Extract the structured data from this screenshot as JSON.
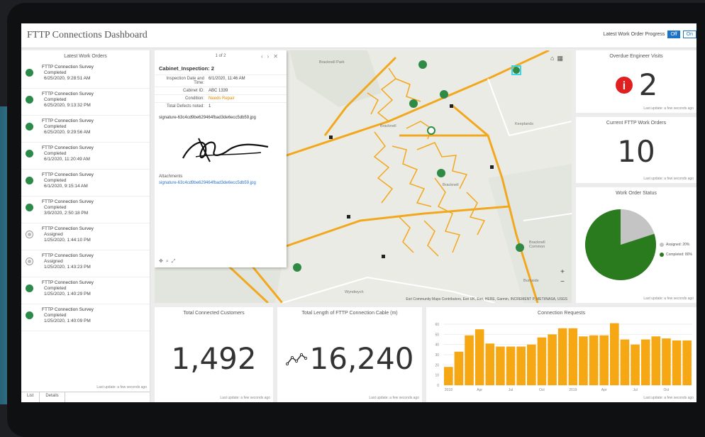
{
  "header": {
    "title": "FTTP Connections Dashboard",
    "selector_label": "Latest Work Order Progress",
    "toggle_off": "Off",
    "toggle_on": "On"
  },
  "work_orders": {
    "title": "Latest Work Orders",
    "items": [
      {
        "title": "FTTP Connection Survey",
        "status": "Completed",
        "date": "6/25/2020, 9:28:51 AM",
        "state": "completed"
      },
      {
        "title": "FTTP Connection Survey",
        "status": "Completed",
        "date": "6/25/2020, 9:13:32 PM",
        "state": "completed"
      },
      {
        "title": "FTTP Connection Survey",
        "status": "Completed",
        "date": "6/25/2020, 9:29:56 AM",
        "state": "completed"
      },
      {
        "title": "FTTP Connection Survey",
        "status": "Completed",
        "date": "6/1/2020, 11:20:49 AM",
        "state": "completed"
      },
      {
        "title": "FTTP Connection Survey",
        "status": "Completed",
        "date": "6/1/2020, 9:15:14 AM",
        "state": "completed"
      },
      {
        "title": "FTTP Connection Survey",
        "status": "Completed",
        "date": "3/9/2020, 2:50:18 PM",
        "state": "completed"
      },
      {
        "title": "FTTP Connection Survey",
        "status": "Assigned",
        "date": "1/25/2020, 1:44:10 PM",
        "state": "assigned"
      },
      {
        "title": "FTTP Connection Survey",
        "status": "Assigned",
        "date": "1/25/2020, 1:43:23 PM",
        "state": "assigned"
      },
      {
        "title": "FTTP Connection Survey",
        "status": "Completed",
        "date": "1/25/2020, 1:40:29 PM",
        "state": "completed"
      },
      {
        "title": "FTTP Connection Survey",
        "status": "Completed",
        "date": "1/25/2020, 1:40:09 PM",
        "state": "completed"
      }
    ],
    "last_update": "Last update: a few seconds ago",
    "tabs": [
      "List",
      "Details"
    ]
  },
  "popup": {
    "counter": "1 of 2",
    "title": "Cabinet_Inspection: 2",
    "fields": [
      {
        "label": "Inspection Date and Time:",
        "value": "6/1/2020, 11:46 AM"
      },
      {
        "label": "Cabinet ID:",
        "value": "ABC 1339"
      },
      {
        "label": "Condition:",
        "value": "Needs Repair"
      },
      {
        "label": "Total Defects noted:",
        "value": "1"
      }
    ],
    "signature_file": "signature-63c4cd9be629464fbad3de6ecc5db59.jpg",
    "attachments_label": "Attachments",
    "attachment_link": "signature-63c4cd9be629464fbad3de6ecc5db59.jpg"
  },
  "map": {
    "attribution": "Esri Community Maps Contributors, Esri UK, Esri, HERE, Garmin, INCREMENT P, METI/NASA, USGS",
    "places": [
      "Bracknell Park",
      "Bracknell",
      "Keeplands",
      "Bracknell",
      "Bracknell Common",
      "Wyndwych",
      "Burnside"
    ]
  },
  "engineer_visits": {
    "title": "Overdue Engineer Visits",
    "value": "2",
    "last_update": "Last update: a few seconds ago"
  },
  "current_orders": {
    "title": "Current FTTP Work Orders",
    "value": "10",
    "last_update": "Last update: a few seconds ago"
  },
  "status_chart": {
    "title": "Work Order Status",
    "last_update": "Last update: a few seconds ago",
    "legend": [
      {
        "label": "Assigned: 20%",
        "color": "#c4c4c4"
      },
      {
        "label": "Completed: 80%",
        "color": "#2a7a1e"
      }
    ]
  },
  "customers": {
    "title": "Total Connected Customers",
    "value": "1,492",
    "last_update": "Last update: a few seconds ago"
  },
  "cable_length": {
    "title": "Total Length of FTTP Connection Cable (m)",
    "value": "16,240",
    "last_update": "Last update: a few seconds ago"
  },
  "requests_chart": {
    "title": "Connection Requests",
    "last_update": "Last update: a few seconds ago"
  },
  "chart_data": [
    {
      "type": "pie",
      "title": "Work Order Status",
      "categories": [
        "Assigned",
        "Completed"
      ],
      "values": [
        20,
        80
      ],
      "colors": [
        "#c4c4c4",
        "#2a7a1e"
      ]
    },
    {
      "type": "bar",
      "title": "Connection Requests",
      "categories": [
        "2018",
        "",
        "",
        "Apr",
        "",
        "",
        "Jul",
        "",
        "",
        "Oct",
        "",
        "",
        "2019",
        "",
        "",
        "Apr",
        "",
        "",
        "Jul",
        "",
        "",
        "Oct",
        "",
        ""
      ],
      "values": [
        18,
        33,
        49,
        55,
        41,
        38,
        38,
        38,
        40,
        47,
        50,
        56,
        56,
        48,
        49,
        49,
        61,
        45,
        40,
        45,
        48,
        46,
        44,
        44
      ],
      "ylim": [
        0,
        60
      ],
      "yticks": [
        "60",
        "50",
        "40",
        "30",
        "20",
        "10",
        "0"
      ],
      "color": "#f5a814"
    }
  ]
}
